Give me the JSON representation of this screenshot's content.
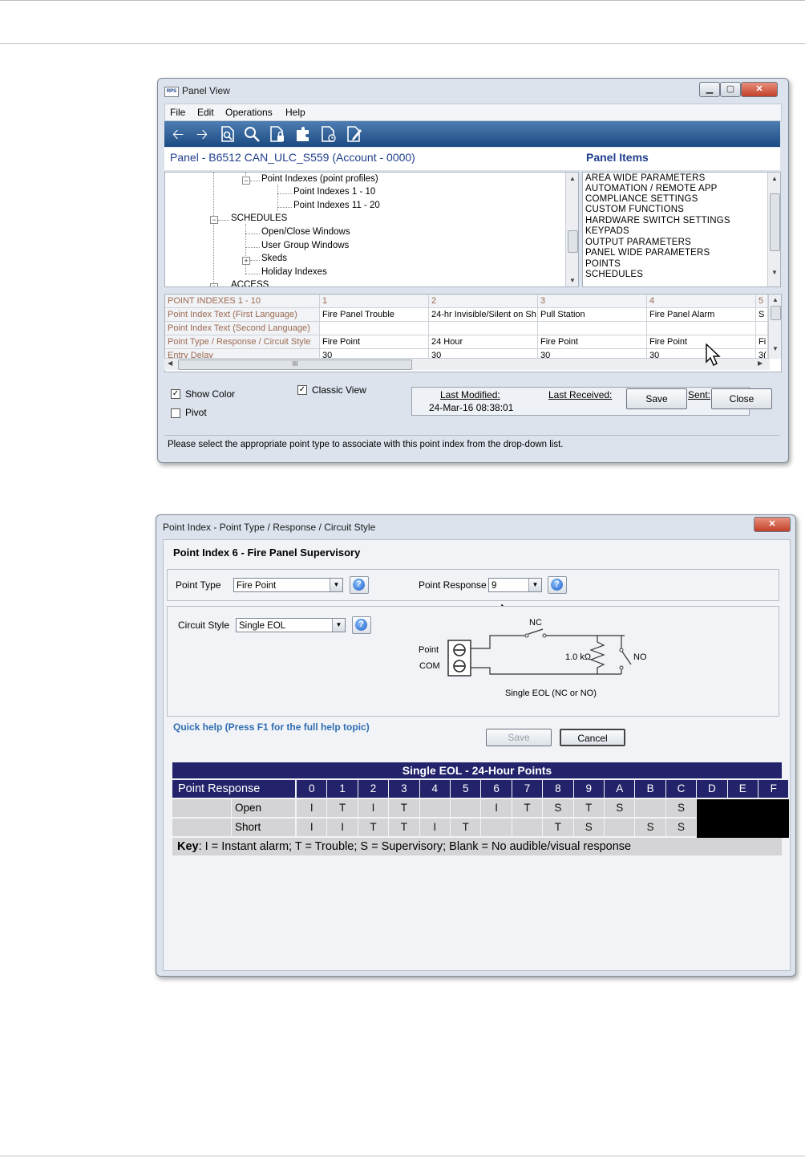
{
  "panel_view": {
    "title": "Panel View",
    "app_icon_text": "RPS",
    "menu": [
      "File",
      "Edit",
      "Operations",
      "Help"
    ],
    "header_left": "Panel - B6512 CAN_ULC_S559 (Account - 0000)",
    "header_right": "Panel Items",
    "tree": [
      {
        "label": "Point Indexes (point profiles)"
      },
      {
        "label": "Point Indexes 1 - 10"
      },
      {
        "label": "Point Indexes 11 - 20"
      },
      {
        "label": "SCHEDULES"
      },
      {
        "label": "Open/Close Windows"
      },
      {
        "label": "User Group Windows"
      },
      {
        "label": "Skeds"
      },
      {
        "label": "Holiday Indexes"
      },
      {
        "label": "ACCESS"
      }
    ],
    "panel_items": [
      "AREA WIDE PARAMETERS",
      "AUTOMATION / REMOTE APP",
      "COMPLIANCE SETTINGS",
      "CUSTOM FUNCTIONS",
      "HARDWARE SWITCH SETTINGS",
      "KEYPADS",
      "OUTPUT PARAMETERS",
      "PANEL WIDE PARAMETERS",
      "POINTS",
      "SCHEDULES"
    ],
    "grid": {
      "headers": [
        "POINT INDEXES 1 - 10",
        "1",
        "2",
        "3",
        "4",
        "5"
      ],
      "rows": [
        {
          "label": "Point Index Text (First Language)",
          "values": [
            "Fire Panel Trouble",
            "24-hr Invisible/Silent on Sh",
            "Pull Station",
            "Fire Panel Alarm",
            "S"
          ]
        },
        {
          "label": "Point Index Text (Second Language)",
          "values": [
            "",
            "",
            "",
            "",
            ""
          ]
        },
        {
          "label": "Point Type / Response / Circuit Style",
          "values": [
            "Fire Point",
            "24 Hour",
            "Fire Point",
            "Fire Point",
            "Fi"
          ]
        },
        {
          "label": "Entry Delay",
          "values": [
            "30",
            "30",
            "30",
            "30",
            "3("
          ]
        }
      ],
      "hscroll_mark": "III"
    },
    "show_color": {
      "label": "Show Color",
      "checked": true
    },
    "pivot": {
      "label": "Pivot",
      "checked": false
    },
    "classic_view": {
      "label": "Classic View",
      "checked": true
    },
    "last_modified_label": "Last Modified:",
    "last_received_label": "Last Received:",
    "sent_label": "Sent:",
    "last_modified_value": "24-Mar-16 08:38:01",
    "save_label": "Save",
    "close_label": "Close",
    "status": "Please select the appropriate point type to associate with this point index from the drop-down list."
  },
  "point_dialog": {
    "title": "Point Index - Point Type / Response / Circuit Style",
    "heading": "Point Index 6 - Fire Panel Supervisory",
    "point_type_label": "Point Type",
    "point_type_value": "Fire Point",
    "point_response_label": "Point Response",
    "point_response_value": "9",
    "circuit_style_label": "Circuit Style",
    "circuit_style_value": "Single EOL",
    "diagram": {
      "nc": "NC",
      "no": "NO",
      "point": "Point",
      "com": "COM",
      "resistor": "1.0 kΩ",
      "caption": "Single EOL (NC or NO)"
    },
    "quick_help": "Quick help (Press F1 for the full help topic)",
    "save_label": "Save",
    "cancel_label": "Cancel",
    "table": {
      "title": "Single EOL - 24-Hour Points",
      "header_label": "Point Response",
      "columns": [
        "0",
        "1",
        "2",
        "3",
        "4",
        "5",
        "6",
        "7",
        "8",
        "9",
        "A",
        "B",
        "C",
        "D",
        "E",
        "F"
      ],
      "rows": [
        {
          "label": "Open",
          "values": [
            "I",
            "T",
            "I",
            "T",
            "",
            "",
            "I",
            "T",
            "S",
            "T",
            "S",
            "",
            "S",
            "",
            "",
            ""
          ]
        },
        {
          "label": "Short",
          "values": [
            "I",
            "I",
            "T",
            "T",
            "I",
            "T",
            "",
            "",
            "T",
            "S",
            "",
            "S",
            "S",
            "",
            "",
            ""
          ]
        }
      ],
      "key_bold": "Key",
      "key_text": ": I = Instant alarm; T = Trouble; S = Supervisory; Blank = No audible/visual response"
    }
  },
  "colors": {
    "toolbar": "#1c4a82",
    "header_text": "#1f3f8c",
    "table_header": "#23236b",
    "quick_help": "#2f6db3"
  }
}
